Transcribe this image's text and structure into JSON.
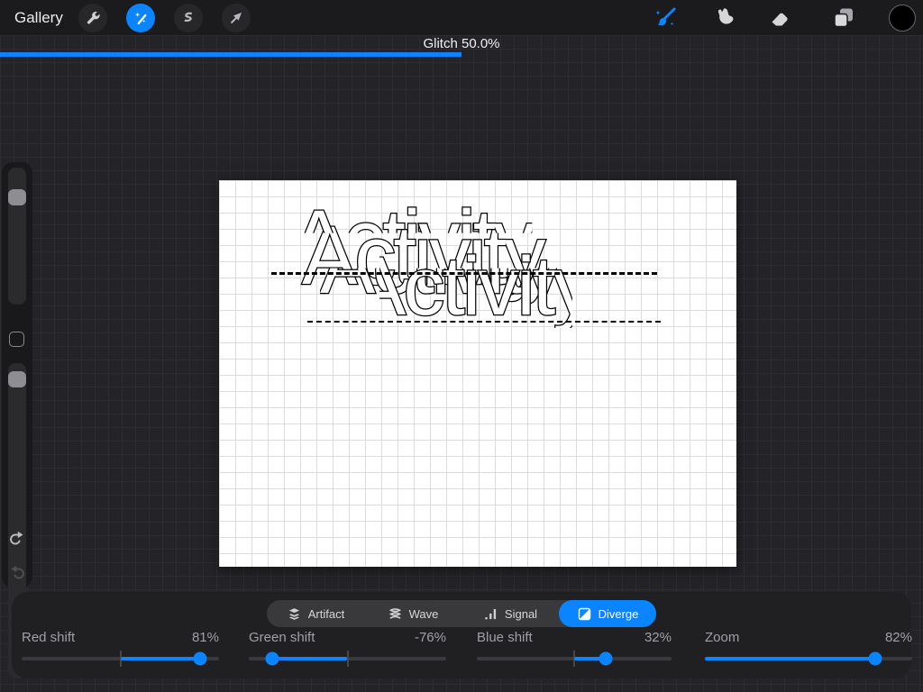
{
  "top_bar": {
    "gallery_label": "Gallery",
    "left_tools": [
      {
        "name": "actions",
        "icon": "wrench-icon",
        "selected": false
      },
      {
        "name": "adjustments",
        "icon": "magic-wand-icon",
        "selected": true
      },
      {
        "name": "selection",
        "icon": "selection-s-icon",
        "selected": false
      },
      {
        "name": "transform",
        "icon": "transform-arrow-icon",
        "selected": false
      }
    ],
    "right_tools": [
      {
        "name": "paint",
        "icon": "paintbrush-icon",
        "selected": true
      },
      {
        "name": "smudge",
        "icon": "smudge-finger-icon",
        "selected": false
      },
      {
        "name": "erase",
        "icon": "eraser-icon",
        "selected": false
      },
      {
        "name": "layers",
        "icon": "layers-icon",
        "selected": false
      },
      {
        "name": "color",
        "icon": "color-swatch-black",
        "selected": false
      }
    ]
  },
  "adjustment": {
    "label": "Glitch 50.0%",
    "percent": 50
  },
  "sidebar": {
    "controls": [
      "brush-size-slider",
      "modify-button",
      "opacity-slider",
      "undo-button",
      "redo-button"
    ]
  },
  "canvas": {
    "text": "Activity"
  },
  "bottom_panel": {
    "modes": [
      {
        "label": "Artifact",
        "icon": "artifact-stack-icon",
        "selected": false
      },
      {
        "label": "Wave",
        "icon": "wave-icon",
        "selected": false
      },
      {
        "label": "Signal",
        "icon": "signal-bars-icon",
        "selected": false
      },
      {
        "label": "Diverge",
        "icon": "diverge-split-icon",
        "selected": true
      }
    ],
    "sliders": [
      {
        "label": "Red shift",
        "value_label": "81%",
        "value": 81,
        "centered": true
      },
      {
        "label": "Green shift",
        "value_label": "-76%",
        "value": -76,
        "centered": true
      },
      {
        "label": "Blue shift",
        "value_label": "32%",
        "value": 32,
        "centered": true
      },
      {
        "label": "Zoom",
        "value_label": "82%",
        "value": 82,
        "centered": false
      }
    ]
  },
  "colors": {
    "accent": "#0A84FF",
    "topbar_bg": "#1B1B1D",
    "workspace_bg": "#242428",
    "panel_bg": "#202023",
    "canvas_bg": "#FFFFFF",
    "swatch_color": "#000000"
  }
}
